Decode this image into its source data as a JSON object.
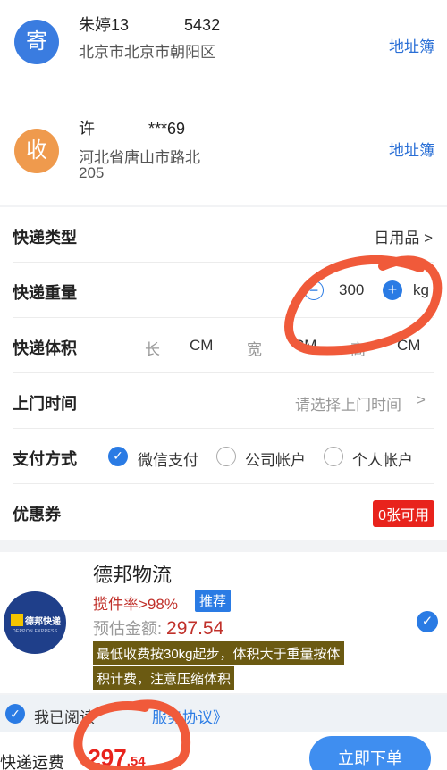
{
  "sender": {
    "icon_label": "寄",
    "icon_color": "#3a7ce0",
    "name_phone": "朱婷13",
    "phone_tail": "5432",
    "address": "北京市北京市朝阳区",
    "address_book": "地址簿"
  },
  "receiver": {
    "icon_label": "收",
    "icon_color": "#ef9a4d",
    "name": "许",
    "phone_masked": "***69",
    "address": "河北省唐山市路北",
    "address_line2": "205",
    "address_book": "地址簿"
  },
  "form": {
    "type": {
      "label": "快递类型",
      "value": "日用品 >"
    },
    "weight": {
      "label": "快递重量",
      "value": "300",
      "unit": "kg",
      "minus": "−",
      "plus": "+"
    },
    "volume": {
      "label": "快递体积",
      "length": "长",
      "width": "宽",
      "height": "高",
      "unit": "CM"
    },
    "pickup": {
      "label": "上门时间",
      "placeholder": "请选择上门时间",
      "chevron": ">"
    },
    "payment": {
      "label": "支付方式",
      "options": [
        "微信支付",
        "公司帐户",
        "个人帐户"
      ],
      "selected": "微信支付"
    },
    "coupon": {
      "label": "优惠券",
      "badge": "0张可用"
    }
  },
  "carrier": {
    "logo_text": "德邦快递",
    "logo_subtext": "DEPPON EXPRESS",
    "name": "德邦物流",
    "rate": "揽件率>98%",
    "tag": "推荐",
    "estimate_label": "预估金额:",
    "estimate_value": "297.54",
    "note_line1": "最低收费按30kg起步，体积大于重量按体",
    "note_line2": "积计费，注意压缩体积",
    "selected": true
  },
  "agreement": {
    "prefix": "我已阅读",
    "link": "服务协议》"
  },
  "bottom": {
    "label": "快递运费",
    "currency": "¥",
    "price_int": "297",
    "price_dec": ".54",
    "submit": "立即下单"
  },
  "colors": {
    "accent": "#2a7be4",
    "price_red": "#e8231c",
    "annotation": "#f05a3a"
  }
}
